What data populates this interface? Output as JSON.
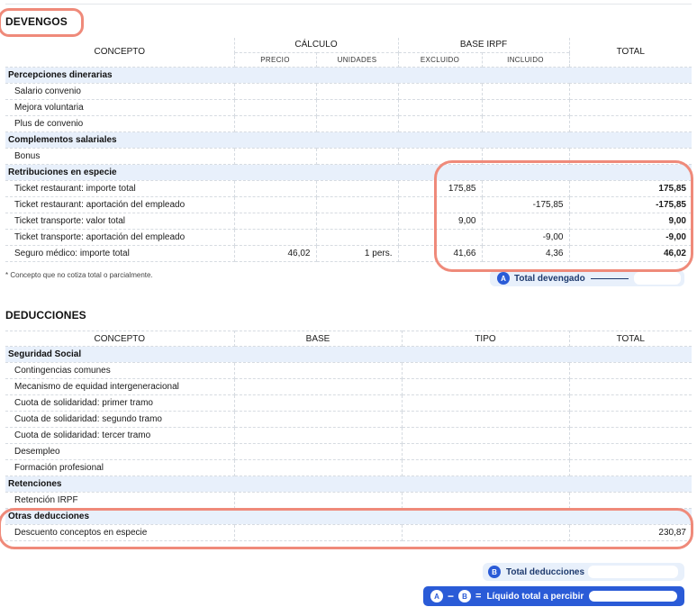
{
  "devengos": {
    "title": "DEVENGOS",
    "headers": {
      "concepto": "CONCEPTO",
      "calculo": "CÁLCULO",
      "precio": "PRECIO",
      "unidades": "UNIDADES",
      "base_irpf": "BASE IRPF",
      "excluido": "EXCLUIDO",
      "incluido": "INCLUIDO",
      "total": "TOTAL"
    },
    "groups": [
      {
        "name": "Percepciones dinerarias",
        "rows": [
          {
            "concepto": "Salario convenio",
            "precio": "",
            "unidades": "",
            "excluido": "",
            "incluido": "",
            "total": ""
          },
          {
            "concepto": "Mejora voluntaria",
            "precio": "",
            "unidades": "",
            "excluido": "",
            "incluido": "",
            "total": ""
          },
          {
            "concepto": "Plus de convenio",
            "precio": "",
            "unidades": "",
            "excluido": "",
            "incluido": "",
            "total": ""
          }
        ]
      },
      {
        "name": "Complementos salariales",
        "rows": [
          {
            "concepto": "Bonus",
            "precio": "",
            "unidades": "",
            "excluido": "",
            "incluido": "",
            "total": ""
          }
        ]
      },
      {
        "name": "Retribuciones en especie",
        "rows": [
          {
            "concepto": "Ticket restaurant: importe total",
            "precio": "",
            "unidades": "",
            "excluido": "175,85",
            "incluido": "",
            "total": "175,85"
          },
          {
            "concepto": "Ticket restaurant: aportación del empleado",
            "precio": "",
            "unidades": "",
            "excluido": "",
            "incluido": "-175,85",
            "total": "-175,85"
          },
          {
            "concepto": "Ticket transporte: valor total",
            "precio": "",
            "unidades": "",
            "excluido": "9,00",
            "incluido": "",
            "total": "9,00"
          },
          {
            "concepto": "Ticket transporte: aportación del empleado",
            "precio": "",
            "unidades": "",
            "excluido": "",
            "incluido": "-9,00",
            "total": "-9,00"
          },
          {
            "concepto": "Seguro médico: importe total",
            "precio": "46,02",
            "unidades": "1 pers.",
            "excluido": "41,66",
            "incluido": "4,36",
            "total": "46,02"
          }
        ]
      }
    ],
    "footnote": "* Concepto que no cotiza total o parcialmente.",
    "total_label": "Total devengado",
    "total_badge": "A"
  },
  "deducciones": {
    "title": "DEDUCCIONES",
    "headers": {
      "concepto": "CONCEPTO",
      "base": "BASE",
      "tipo": "TIPO",
      "total": "TOTAL"
    },
    "groups": [
      {
        "name": "Seguridad Social",
        "rows": [
          {
            "concepto": "Contingencias comunes",
            "base": "",
            "tipo": "",
            "total": ""
          },
          {
            "concepto": "Mecanismo de equidad intergeneracional",
            "base": "",
            "tipo": "",
            "total": ""
          },
          {
            "concepto": "Cuota de solidaridad: primer tramo",
            "base": "",
            "tipo": "",
            "total": ""
          },
          {
            "concepto": "Cuota de solidaridad: segundo tramo",
            "base": "",
            "tipo": "",
            "total": ""
          },
          {
            "concepto": "Cuota de solidaridad: tercer tramo",
            "base": "",
            "tipo": "",
            "total": ""
          },
          {
            "concepto": "Desempleo",
            "base": "",
            "tipo": "",
            "total": ""
          },
          {
            "concepto": "Formación profesional",
            "base": "",
            "tipo": "",
            "total": ""
          }
        ]
      },
      {
        "name": "Retenciones",
        "rows": [
          {
            "concepto": "Retención IRPF",
            "base": "",
            "tipo": "",
            "total": ""
          }
        ]
      },
      {
        "name": "Otras deducciones",
        "rows": [
          {
            "concepto": "Descuento conceptos en especie",
            "base": "",
            "tipo": "",
            "total": "230,87"
          }
        ]
      }
    ],
    "total_label": "Total deducciones",
    "total_badge": "B"
  },
  "liquido": {
    "badge_a": "A",
    "minus": "−",
    "badge_b": "B",
    "equals": "=",
    "label": "Líquido total a percibir"
  },
  "colors": {
    "highlight": "#ef8a7a",
    "category_bg": "#e8f0fb",
    "accent": "#2a5bd7"
  }
}
